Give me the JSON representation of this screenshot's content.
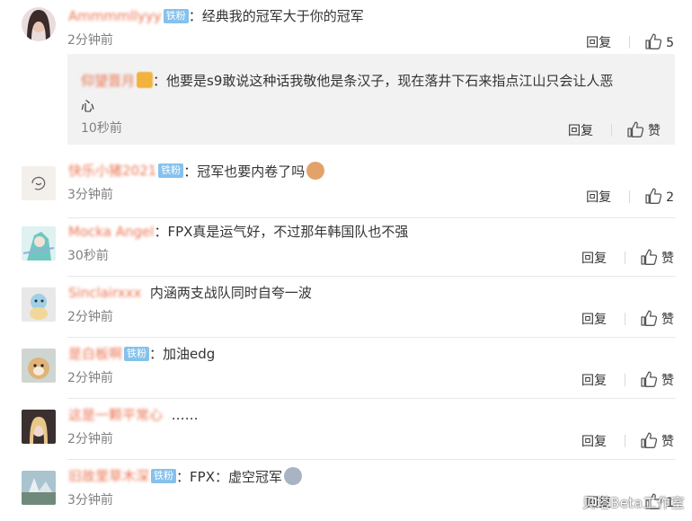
{
  "comments": [
    {
      "username": "Ammmmllyyy",
      "badge": "铁粉",
      "text": "经典我的冠军大于你的冠军",
      "time": "2分钟前",
      "reply_label": "回复",
      "like_label": "5",
      "avatar": "woman-avatar",
      "subreply": {
        "username": "仰望晋月",
        "text_line1": "他要是s9敢说这种话我敬他是条汉子，现在落井下石来指点江山只会让人恶",
        "text_line2": "心",
        "time": "10秒前",
        "reply_label": "回复",
        "like_label": "赞"
      }
    },
    {
      "username": "快乐小猪2021",
      "badge": "铁粉",
      "text": "冠军也要内卷了吗",
      "time": "3分钟前",
      "reply_label": "回复",
      "like_label": "2",
      "avatar": "doodle-avatar",
      "emoji": "cat-emoji"
    },
    {
      "username": "Mocka Angel",
      "badge": "",
      "text": "FPX真是运气好，不过那年韩国队也不强",
      "time": "30秒前",
      "reply_label": "回复",
      "like_label": "赞",
      "avatar": "anime-avatar"
    },
    {
      "username": "Sinclairxxx",
      "badge": "",
      "text": "内涵两支战队同时自夸一波",
      "time": "2分钟前",
      "reply_label": "回复",
      "like_label": "赞",
      "avatar": "pokemon-avatar"
    },
    {
      "username": "是白板啊",
      "badge": "铁粉",
      "text": "加油edg",
      "time": "2分钟前",
      "reply_label": "回复",
      "like_label": "赞",
      "avatar": "dog-avatar"
    },
    {
      "username": "这是一颗平常心",
      "badge": "",
      "text": "……",
      "time": "2分钟前",
      "reply_label": "回复",
      "like_label": "赞",
      "avatar": "girl-avatar"
    },
    {
      "username": "旧故里草木深",
      "badge": "铁粉",
      "text": "FPX：虚空冠军",
      "time": "3分钟前",
      "reply_label": "回复",
      "like_label": "1",
      "avatar": "scenery-avatar",
      "emoji": "shocked-emoji"
    }
  ],
  "watermark": "贝塔Beta工作室",
  "colors": {
    "username": "#eb7350",
    "badge": "#85c1ec",
    "subreply_bg": "#f2f2f2",
    "time": "#808080"
  }
}
